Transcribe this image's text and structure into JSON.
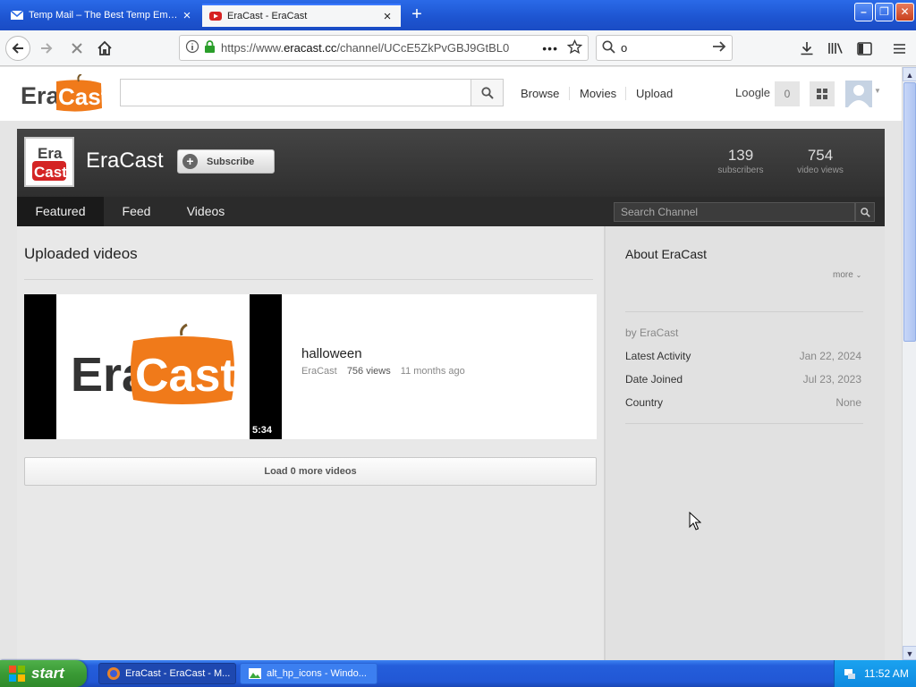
{
  "browser": {
    "tabs": [
      {
        "title": "Temp Mail – The Best Temp Email Ser",
        "active": false
      },
      {
        "title": "EraCast - EraCast",
        "active": true
      }
    ],
    "url_prefix": "https://www.",
    "url_domain": "eracast.cc",
    "url_path": "/channel/UCcE5ZkPvGBJ9GtBL0",
    "search_value": "o"
  },
  "site": {
    "logo_text_1": "Era",
    "logo_text_2": "Cast",
    "nav": [
      "Browse",
      "Movies",
      "Upload"
    ],
    "user_name": "Loogle",
    "notification_count": "0"
  },
  "channel": {
    "logo_text_1": "Era",
    "logo_text_2": "Cast",
    "name": "EraCast",
    "subscribe_label": "Subscribe",
    "subscribers": "139",
    "subscribers_label": "subscribers",
    "video_views": "754",
    "video_views_label": "video views",
    "tabs": [
      "Featured",
      "Feed",
      "Videos"
    ],
    "search_placeholder": "Search Channel"
  },
  "uploads": {
    "title": "Uploaded videos",
    "videos": [
      {
        "title": "halloween",
        "author": "EraCast",
        "views": "756 views",
        "age": "11 months ago",
        "duration": "5:34",
        "thumb_text_1": "Era",
        "thumb_text_2": "Cast"
      }
    ],
    "load_more": "Load 0 more videos"
  },
  "about": {
    "title": "About EraCast",
    "more": "more",
    "by": "by EraCast",
    "rows": [
      {
        "label": "Latest Activity",
        "value": "Jan 22, 2024"
      },
      {
        "label": "Date Joined",
        "value": "Jul 23, 2023"
      },
      {
        "label": "Country",
        "value": "None"
      }
    ]
  },
  "taskbar": {
    "start": "start",
    "tasks": [
      "EraCast - EraCast - M...",
      "alt_hp_icons - Windo..."
    ],
    "clock": "11:52 AM"
  },
  "colors": {
    "brand_orange": "#f07a1a",
    "xp_blue": "#245edb",
    "channel_dark": "#2f2f2f"
  }
}
